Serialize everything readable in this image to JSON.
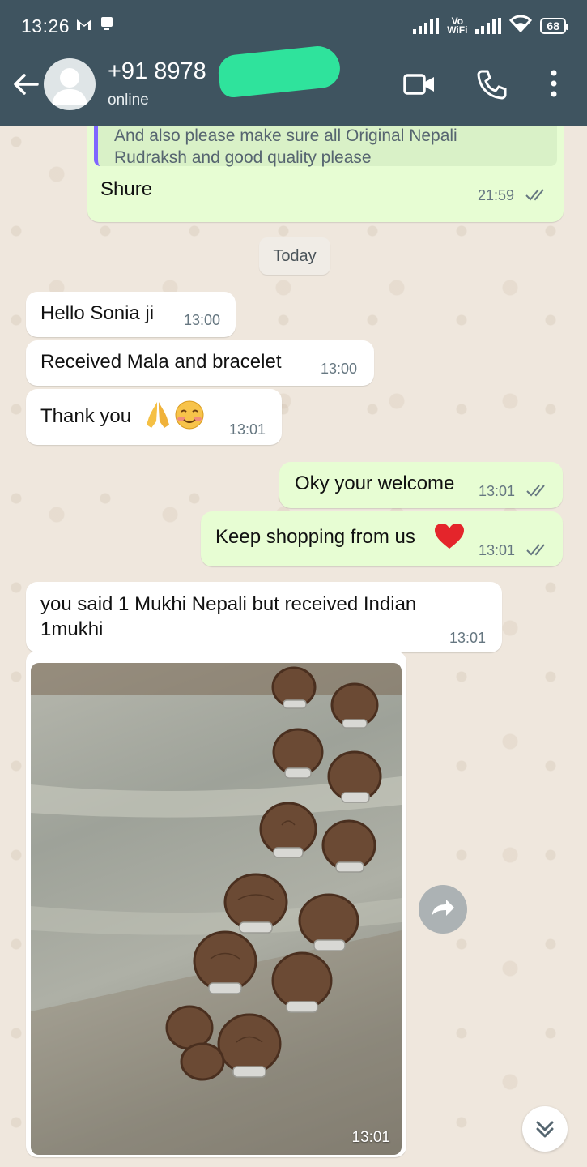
{
  "status_bar": {
    "time": "13:26",
    "vowifi_top": "Vo",
    "vowifi_bottom": "WiFi",
    "battery": "68"
  },
  "header": {
    "contact": "+91 8978",
    "status": "online",
    "icons": [
      "back-arrow-icon",
      "video-call-icon",
      "voice-call-icon",
      "more-options-icon"
    ]
  },
  "messages": {
    "quoted_line1": "And also please make sure all Original Nepali",
    "quoted_line2": "Rudraksh and good quality please",
    "m0_text": "Shure",
    "m0_time": "21:59",
    "date_chip": "Today",
    "m1_text": "Hello Sonia ji",
    "m1_time": "13:00",
    "m2_text": "Received Mala and bracelet",
    "m2_time": "13:00",
    "m3_text": "Thank you",
    "m3_time": "13:01",
    "m4_text": "Oky your welcome",
    "m4_time": "13:01",
    "m5_text": "Keep shopping from us",
    "m5_time": "13:01",
    "m6_line1": "you said 1 Mukhi Nepali but received Indian",
    "m6_line2": "1mukhi",
    "m6_time": "13:01",
    "photo_time": "13:01"
  },
  "colors": {
    "header_bg": "#3f5460",
    "incoming_bubble": "#ffffff",
    "outgoing_bubble": "#e7fdd3",
    "quote_bar": "#7f66ff",
    "redaction": "#2fe39c"
  }
}
